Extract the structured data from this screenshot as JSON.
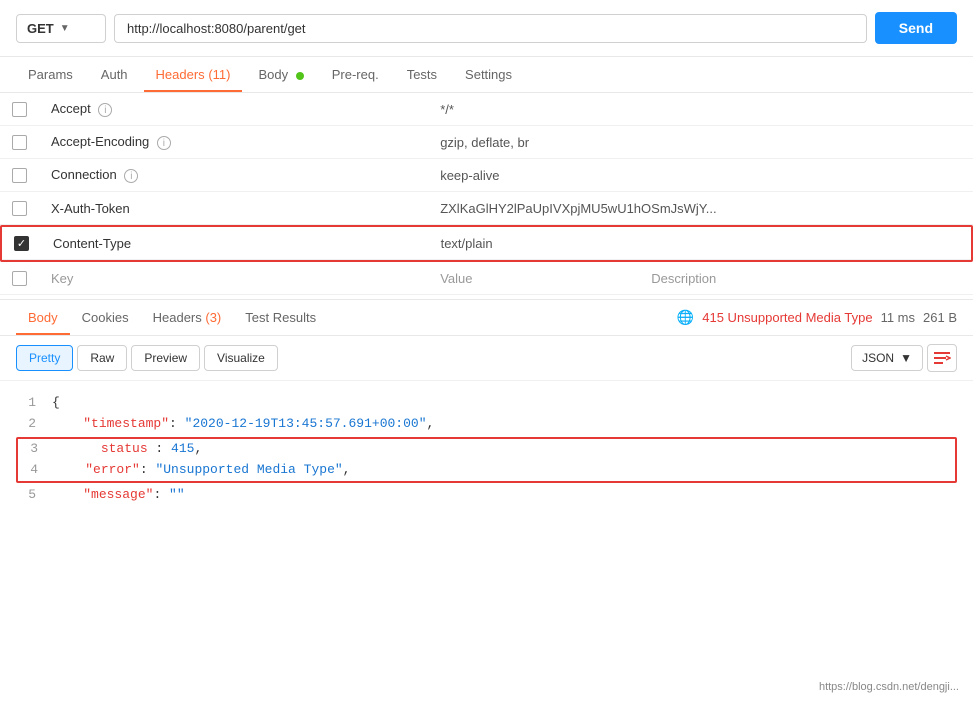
{
  "urlBar": {
    "method": "GET",
    "url": "http://localhost:8080/parent/get",
    "sendLabel": "Send"
  },
  "requestTabs": [
    {
      "id": "params",
      "label": "Params",
      "active": false
    },
    {
      "id": "auth",
      "label": "Auth",
      "active": false
    },
    {
      "id": "headers",
      "label": "Headers",
      "active": true,
      "badge": "(11)"
    },
    {
      "id": "body",
      "label": "Body",
      "active": false,
      "dot": true
    },
    {
      "id": "prereq",
      "label": "Pre-req.",
      "active": false
    },
    {
      "id": "tests",
      "label": "Tests",
      "active": false
    },
    {
      "id": "settings",
      "label": "Settings",
      "active": false
    }
  ],
  "headersTable": {
    "rows": [
      {
        "checked": false,
        "key": "Accept",
        "hasInfo": true,
        "value": "*/*",
        "description": ""
      },
      {
        "checked": false,
        "key": "Accept-Encoding",
        "hasInfo": true,
        "value": "gzip, deflate, br",
        "description": ""
      },
      {
        "checked": false,
        "key": "Connection",
        "hasInfo": true,
        "value": "keep-alive",
        "description": ""
      },
      {
        "checked": false,
        "key": "X-Auth-Token",
        "hasInfo": false,
        "value": "ZXlKaGlHY2lPaUpIVXpjMU5wU1hOSmJsWjY...",
        "description": ""
      },
      {
        "checked": true,
        "key": "Content-Type",
        "hasInfo": false,
        "value": "text/plain",
        "description": "",
        "highlight": true
      }
    ],
    "newRow": {
      "keyPlaceholder": "Key",
      "valuePlaceholder": "Value",
      "descPlaceholder": "Description"
    }
  },
  "responseTabs": [
    {
      "id": "body",
      "label": "Body",
      "active": true
    },
    {
      "id": "cookies",
      "label": "Cookies",
      "active": false
    },
    {
      "id": "headers",
      "label": "Headers",
      "active": false,
      "badge": "(3)"
    },
    {
      "id": "testResults",
      "label": "Test Results",
      "active": false
    }
  ],
  "responseStatus": {
    "statusText": "415 Unsupported Media Type",
    "time": "11 ms",
    "size": "261 B"
  },
  "bodyToolbar": {
    "pretty": "Pretty",
    "raw": "Raw",
    "preview": "Preview",
    "visualize": "Visualize",
    "format": "JSON",
    "activeFormat": "Pretty"
  },
  "codeLines": [
    {
      "num": 1,
      "content": "{",
      "type": "brace"
    },
    {
      "num": 2,
      "content": "\"timestamp\": \"2020-12-19T13:45:57.691+00:00\",",
      "type": "keystring",
      "keyPart": "\"timestamp\"",
      "valuePart": "\"2020-12-19T13:45:57.691+00:00\""
    },
    {
      "num": 3,
      "content": "  status : 415,",
      "type": "keynumber",
      "keyPart": "status",
      "valuePart": "415",
      "highlight": true
    },
    {
      "num": 4,
      "content": "\"error\": \"Unsupported Media Type\",",
      "type": "keystring",
      "keyPart": "\"error\"",
      "valuePart": "\"Unsupported Media Type\"",
      "highlight": true
    },
    {
      "num": 5,
      "content": "\"message\": \"\"",
      "type": "keystring",
      "keyPart": "\"message\"",
      "valuePart": "\"\""
    }
  ],
  "watermark": "https://blog.csdn.net/dengji..."
}
